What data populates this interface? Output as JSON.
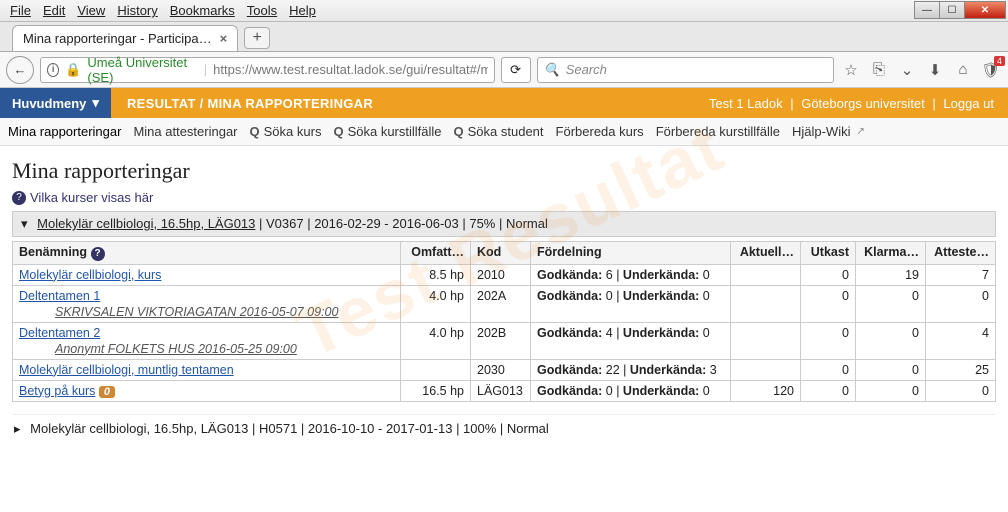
{
  "browser": {
    "menus": [
      "File",
      "Edit",
      "View",
      "History",
      "Bookmarks",
      "Tools",
      "Help"
    ],
    "tab_title": "Mina rapporteringar - Participa…",
    "identity": "Umeå Universitet (SE)",
    "url": "https://www.test.resultat.ladok.se/gui/resultat#/minarapp",
    "search_placeholder": "Search",
    "badge": "4"
  },
  "appbar": {
    "main_menu": "Huvudmeny",
    "crumb": "RESULTAT / MINA RAPPORTERINGAR",
    "user": "Test 1 Ladok",
    "org": "Göteborgs universitet",
    "logout": "Logga ut"
  },
  "secnav": {
    "items": [
      {
        "label": "Mina rapporteringar",
        "active": true
      },
      {
        "label": "Mina attesteringar"
      },
      {
        "label": "Söka kurs",
        "search": true
      },
      {
        "label": "Söka kurstillfälle",
        "search": true
      },
      {
        "label": "Söka student",
        "search": true
      },
      {
        "label": "Förbereda kurs"
      },
      {
        "label": "Förbereda kurstillfälle"
      },
      {
        "label": "Hjälp-Wiki",
        "ext": true
      }
    ]
  },
  "page_title": "Mina rapporteringar",
  "help_text": "Vilka kurser visas här",
  "course_open": {
    "title": "Molekylär cellbiologi, 16.5hp, LÄG013",
    "meta": " | V0367 | 2016-02-29 - 2016-06-03 | 75% | Normal"
  },
  "course_closed": {
    "line": "Molekylär cellbiologi, 16.5hp, LÄG013 | H0571 | 2016-10-10 - 2017-01-13 | 100% | Normal"
  },
  "columns": [
    "Benämning",
    "Omfatt…",
    "Kod",
    "Fördelning",
    "Aktuell…",
    "Utkast",
    "Klarma…",
    "Atteste…"
  ],
  "rows": [
    {
      "name": "Molekylär cellbiologi, kurs",
      "omf": "8.5 hp",
      "kod": "2010",
      "gk": 6,
      "uk": 0,
      "aktuell": "",
      "utkast": 0,
      "klar": 19,
      "att": 7
    },
    {
      "name": "Deltentamen 1",
      "sub": "SKRIVSALEN VIKTORIAGATAN 2016-05-07 09:00",
      "omf": "4.0 hp",
      "kod": "202A",
      "gk": 0,
      "uk": 0,
      "aktuell": "",
      "utkast": 0,
      "klar": 0,
      "att": 0
    },
    {
      "name": "Deltentamen 2",
      "sub": "Anonymt FOLKETS HUS 2016-05-25 09:00",
      "omf": "4.0 hp",
      "kod": "202B",
      "gk": 4,
      "uk": 0,
      "aktuell": "",
      "utkast": 0,
      "klar": 0,
      "att": 4
    },
    {
      "name": "Molekylär cellbiologi, muntlig tentamen",
      "omf": "",
      "kod": "2030",
      "gk": 22,
      "uk": 3,
      "aktuell": "",
      "utkast": 0,
      "klar": 0,
      "att": 25
    },
    {
      "name": "Betyg på kurs",
      "pill": "0",
      "omf": "16.5 hp",
      "kod": "LÄG013",
      "gk": 0,
      "uk": 0,
      "aktuell": 120,
      "utkast": 0,
      "klar": 0,
      "att": 0
    }
  ],
  "labels": {
    "gk": "Godkända:",
    "uk": "Underkända:"
  },
  "watermark": "Test Resultat"
}
